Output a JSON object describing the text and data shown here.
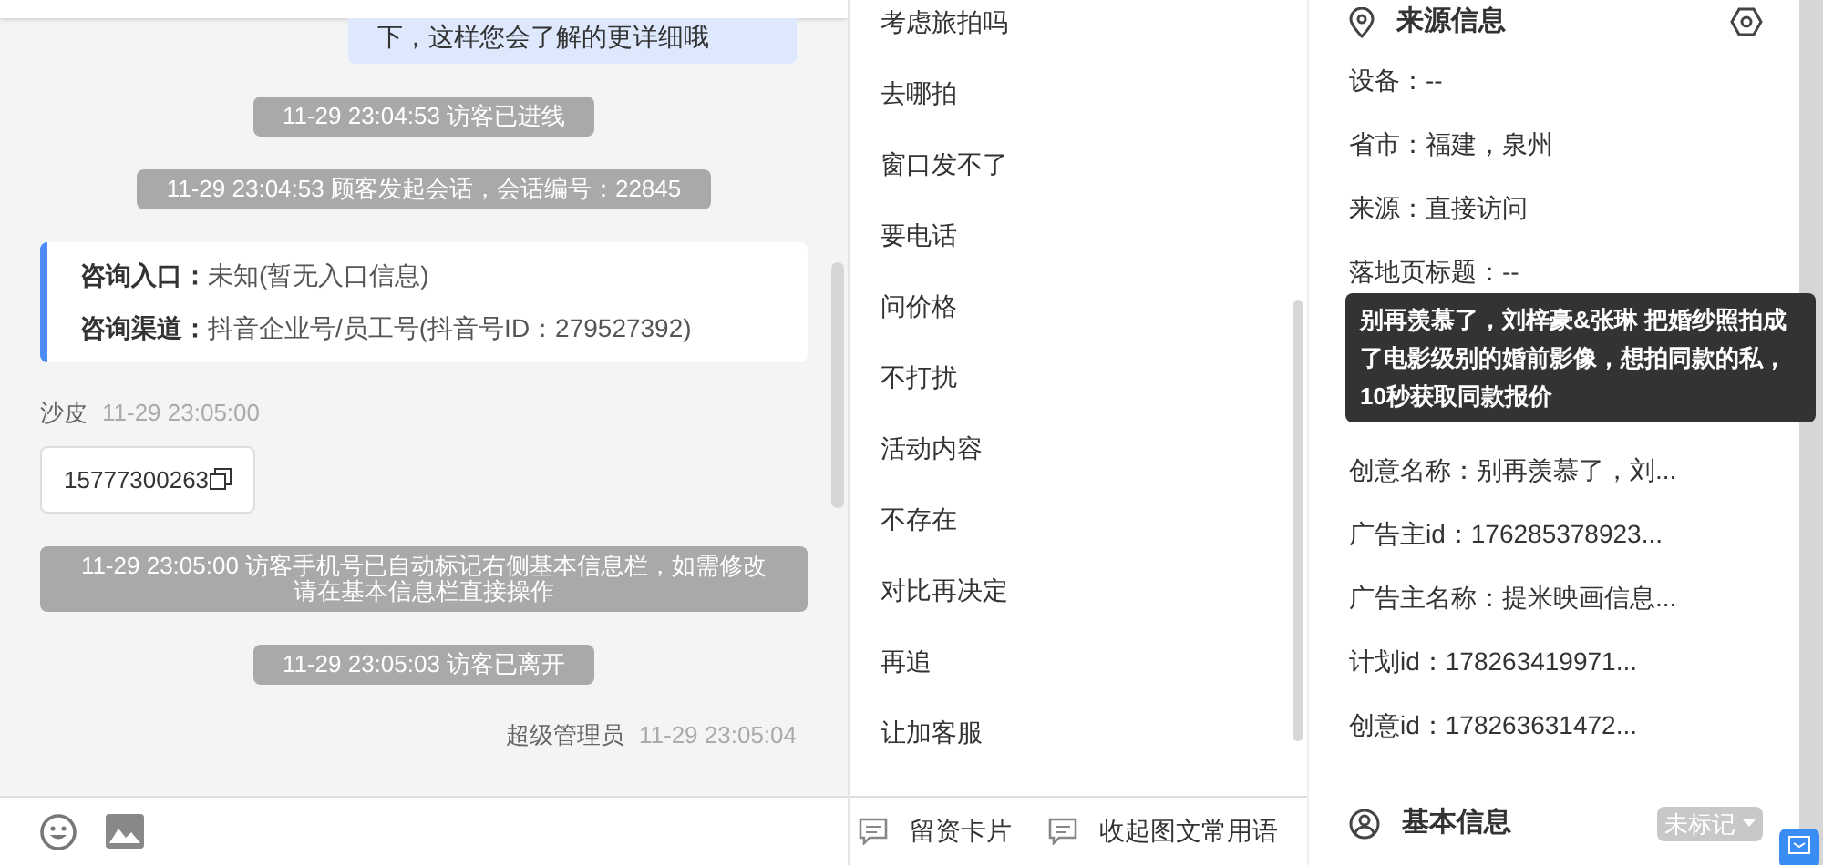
{
  "chat": {
    "messages": [
      {
        "kind": "bubble",
        "text": "下，这样您会了解的更详细哦"
      },
      {
        "kind": "system",
        "text": "11-29 23:04:53 访客已进线"
      },
      {
        "kind": "system",
        "text": "11-29 23:04:53 顾客发起会话，会话编号：22845"
      },
      {
        "kind": "info",
        "rows": [
          {
            "label": "咨询入口：",
            "value": "未知(暂无入口信息)"
          },
          {
            "label": "咨询渠道：",
            "value": "抖音企业号/员工号(抖音号ID：279527392)"
          }
        ]
      },
      {
        "kind": "visitor",
        "sender": "沙皮",
        "time": "11-29 23:05:00",
        "text": "15777300263"
      },
      {
        "kind": "system",
        "text": "11-29 23:05:00 访客手机号已自动标记右侧基本信息栏，如需修改请在基本信息栏直接操作"
      },
      {
        "kind": "system",
        "text": "11-29 23:05:03 访客已离开"
      },
      {
        "kind": "agent",
        "sender": "超级管理员",
        "time": "11-29 23:05:04"
      }
    ]
  },
  "phrases": {
    "items": [
      "考虑旅拍吗",
      "去哪拍",
      "窗口发不了",
      "要电话",
      "问价格",
      "不打扰",
      "活动内容",
      "不存在",
      "对比再决定",
      "再追",
      "让加客服"
    ],
    "actions": [
      "留资卡片",
      "收起图文常用语"
    ]
  },
  "source_info": {
    "title": "来源信息",
    "rows": [
      "设备：--",
      "省市：福建，泉州",
      "来源：直接访问",
      "落地页标题：--"
    ],
    "rows_after": [
      "创意名称：别再羡慕了，刘...",
      "广告主id：176285378923...",
      "广告主名称：提米映画信息...",
      "计划id：178263419971...",
      "创意id：178263631472..."
    ],
    "tooltip": "别再羡慕了，刘梓豪&张琳 把婚纱照拍成了电影级别的婚前影像，想拍同款的私，10秒获取同款报价"
  },
  "basic_info": {
    "title": "基本信息",
    "tag": "未标记"
  }
}
